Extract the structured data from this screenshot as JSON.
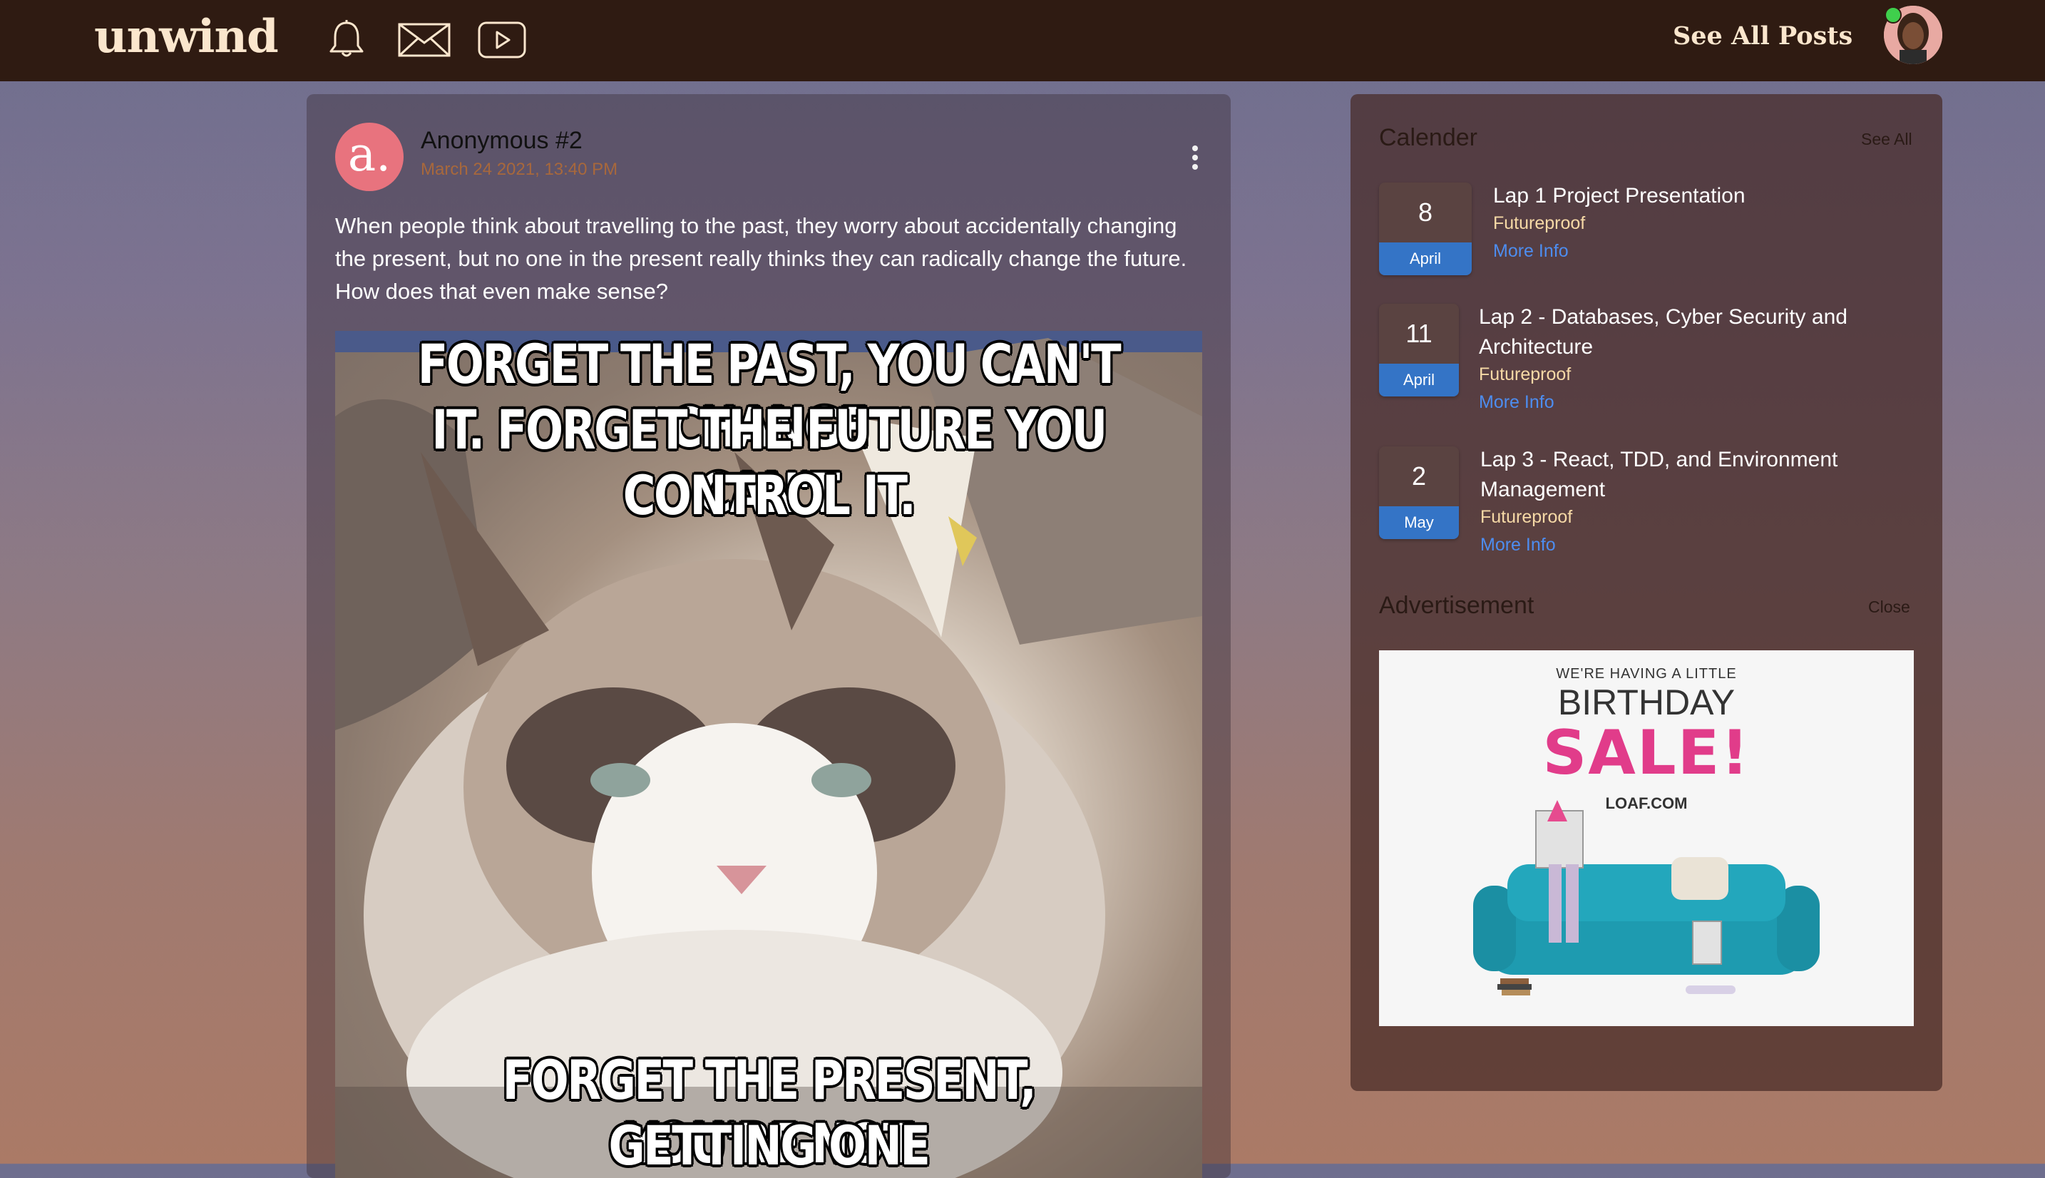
{
  "navbar": {
    "logo": "unwind",
    "see_all_posts": "See All Posts",
    "icons": [
      "bell-icon",
      "envelope-icon",
      "video-play-icon"
    ],
    "colors": {
      "background": "#2f1b12",
      "text": "#fbe6cd",
      "online": "#3fcf4c"
    }
  },
  "post": {
    "avatar_letter": "a.",
    "author": "Anonymous #2",
    "date": "March 24 2021, 13:40 PM",
    "text": "When people think about travelling to the past, they worry about accidentally changing the present, but no one in the present really thinks they can radically change the future. How does that even make sense?",
    "meme": {
      "top": [
        "FORGET THE PAST, YOU CAN'T CHANGE",
        "IT. FORGET THE FUTURE YOU CAN'T",
        "CONTROL IT."
      ],
      "bottom": [
        "FORGET THE PRESENT, YOU'RE NOT",
        "GETTING ONE"
      ]
    }
  },
  "sidebar": {
    "calendar": {
      "title": "Calender",
      "see_all": "See All",
      "events": [
        {
          "day": "8",
          "month": "April",
          "title_lines": [
            "Lap 1 Project Presentation"
          ],
          "org": "Futureproof",
          "link": "More Info"
        },
        {
          "day": "11",
          "month": "April",
          "title_lines": [
            "Lap 2 - Databases, Cyber Security and",
            "Architecture"
          ],
          "org": "Futureproof",
          "link": "More Info"
        },
        {
          "day": "2",
          "month": "May",
          "title_lines": [
            "Lap 3 - React, TDD, and Environment",
            "Management"
          ],
          "org": "Futureproof",
          "link": "More Info"
        }
      ]
    },
    "advertisement": {
      "title": "Advertisement",
      "close": "Close",
      "ad_small": "WE'RE HAVING A LITTLE",
      "ad_big": "BIRTHDAY",
      "ad_sale": "SALE!",
      "ad_domain": "LOAF.COM"
    }
  }
}
